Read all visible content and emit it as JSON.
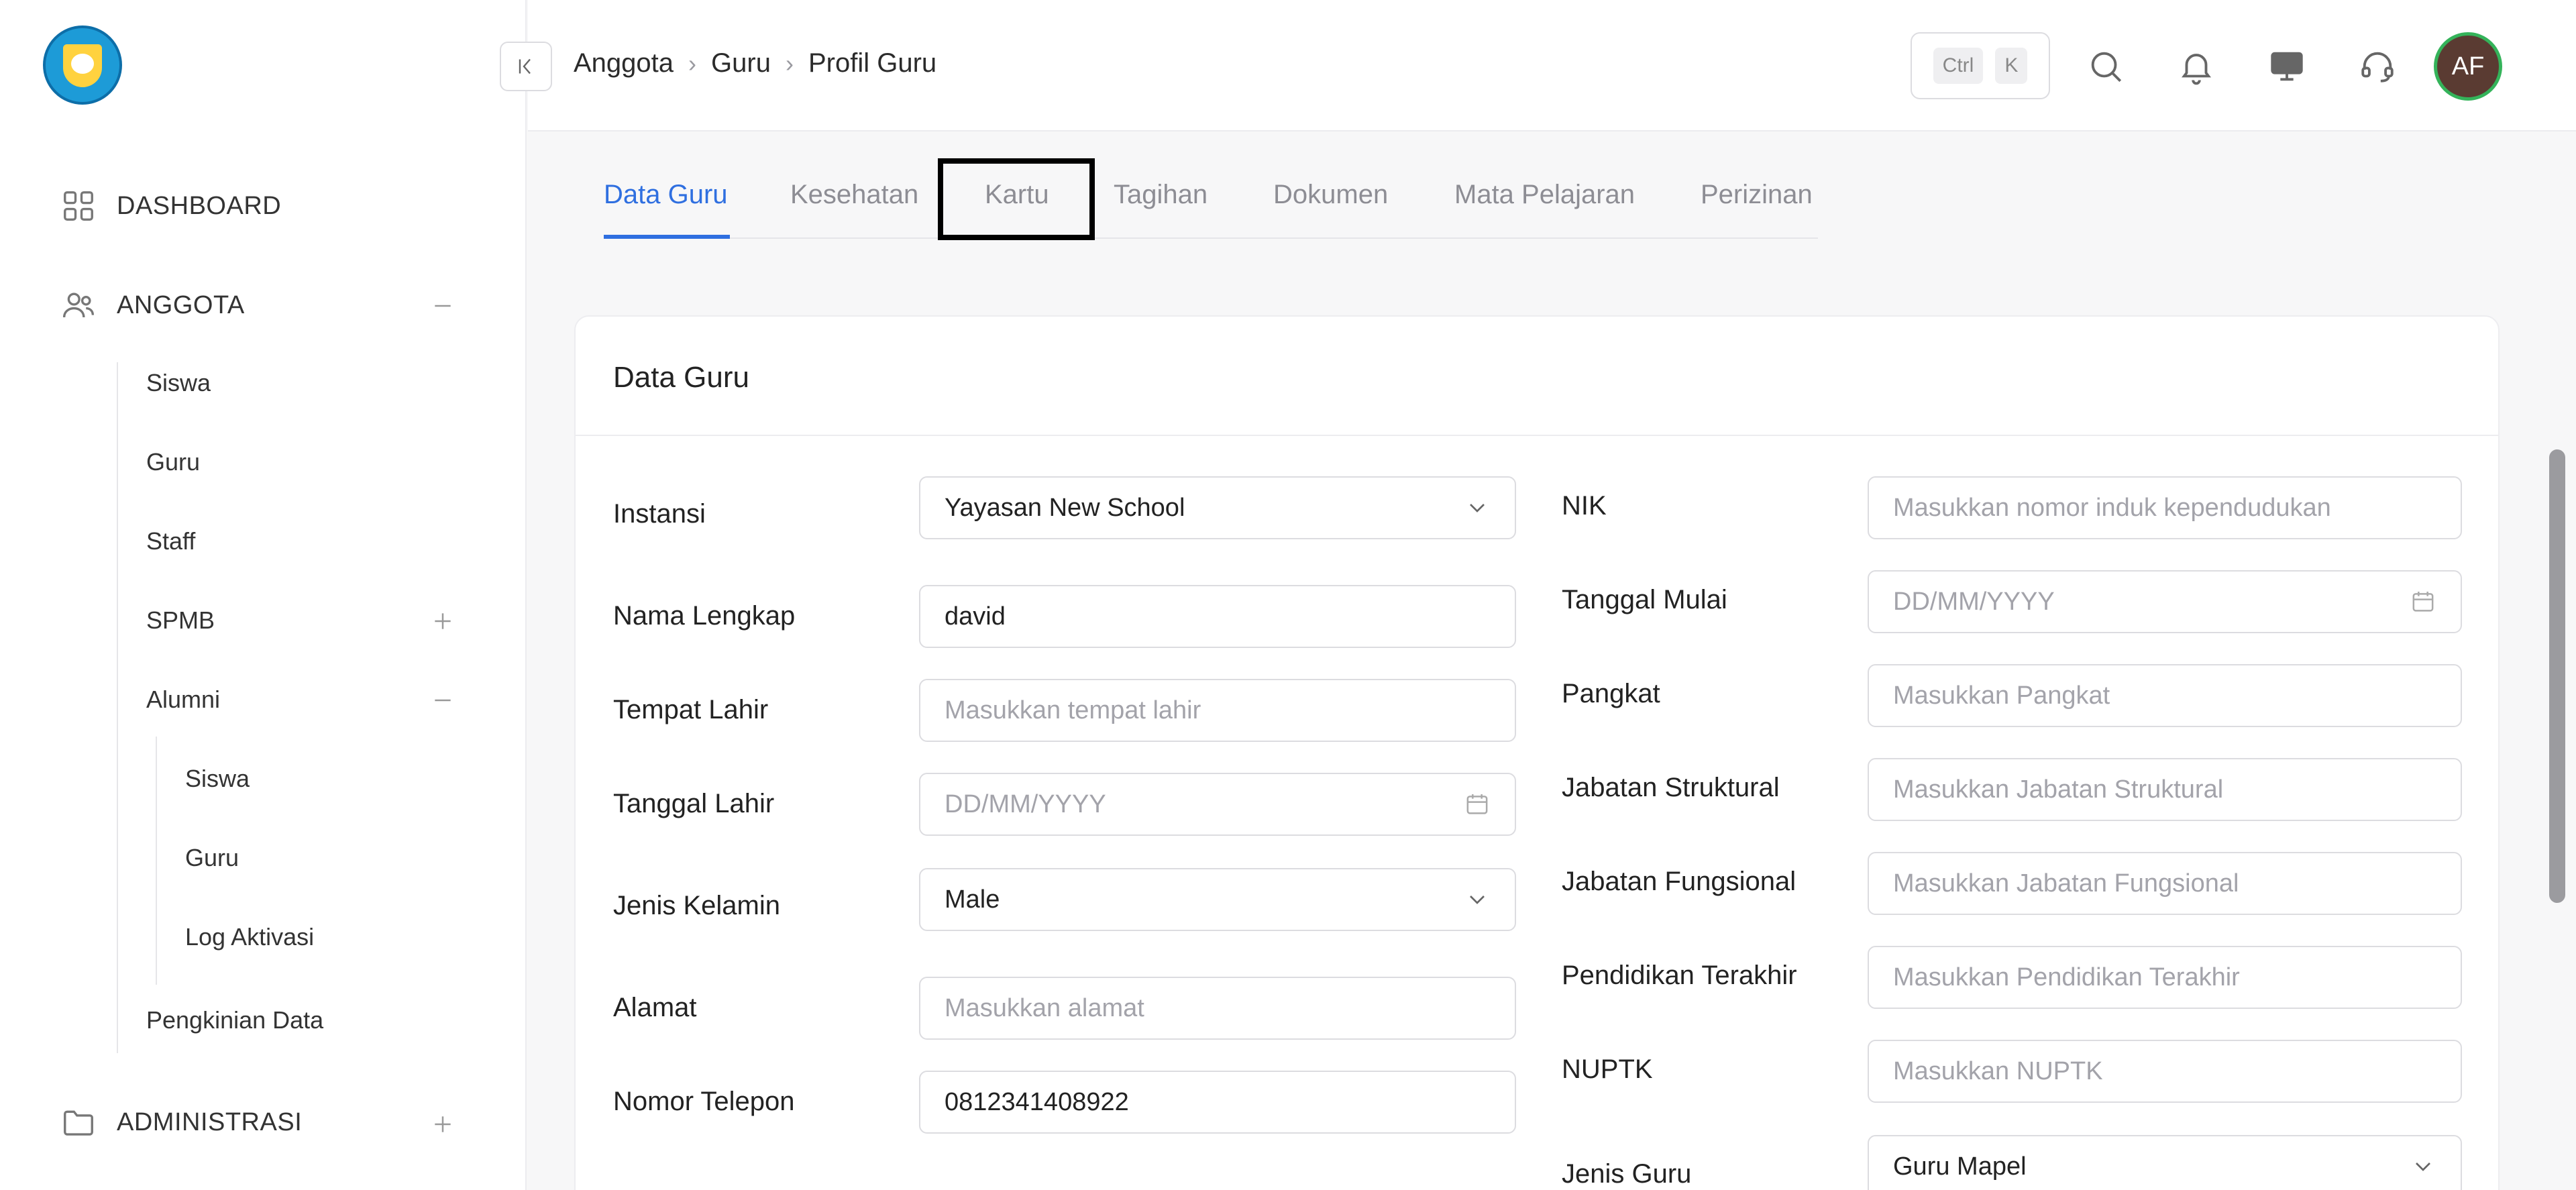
{
  "sidebar": {
    "dashboard": "DASHBOARD",
    "anggota": "ANGGOTA",
    "anggota_items": [
      "Siswa",
      "Guru",
      "Staff",
      "SPMB",
      "Alumni"
    ],
    "alumni_items": [
      "Siswa",
      "Guru",
      "Log Aktivasi"
    ],
    "pengkinian": "Pengkinian Data",
    "administrasi": "ADMINISTRASI"
  },
  "header": {
    "breadcrumb": [
      "Anggota",
      "Guru",
      "Profil Guru"
    ],
    "shortcut_keys": [
      "Ctrl",
      "K"
    ],
    "avatar_initials": "AF"
  },
  "tabs": [
    "Data Guru",
    "Kesehatan",
    "Kartu",
    "Tagihan",
    "Dokumen",
    "Mata Pelajaran",
    "Perizinan"
  ],
  "card": {
    "title": "Data Guru",
    "left_fields": [
      {
        "label": "Instansi",
        "value": "Yayasan New School",
        "placeholder": ""
      },
      {
        "label": "Nama Lengkap",
        "value": "david",
        "placeholder": ""
      },
      {
        "label": "Tempat Lahir",
        "value": "",
        "placeholder": "Masukkan tempat lahir"
      },
      {
        "label": "Tanggal Lahir",
        "value": "",
        "placeholder": "DD/MM/YYYY"
      },
      {
        "label": "Jenis Kelamin",
        "value": "Male",
        "placeholder": ""
      },
      {
        "label": "Alamat",
        "value": "",
        "placeholder": "Masukkan alamat"
      },
      {
        "label": "Nomor Telepon",
        "value": "0812341408922",
        "placeholder": ""
      }
    ],
    "right_fields": [
      {
        "label": "NIK",
        "value": "",
        "placeholder": "Masukkan nomor induk kependudukan"
      },
      {
        "label": "Tanggal Mulai",
        "value": "",
        "placeholder": "DD/MM/YYYY"
      },
      {
        "label": "Pangkat",
        "value": "",
        "placeholder": "Masukkan Pangkat"
      },
      {
        "label": "Jabatan Struktural",
        "value": "",
        "placeholder": "Masukkan Jabatan Struktural"
      },
      {
        "label": "Jabatan Fungsional",
        "value": "",
        "placeholder": "Masukkan Jabatan Fungsional"
      },
      {
        "label": "Pendidikan Terakhir",
        "value": "",
        "placeholder": "Masukkan Pendidikan Terakhir"
      },
      {
        "label": "NUPTK",
        "value": "",
        "placeholder": "Masukkan NUPTK"
      },
      {
        "label": "Jenis Guru",
        "value": "Guru Mapel",
        "placeholder": ""
      }
    ]
  },
  "colors": {
    "accent": "#2f6fe0",
    "avatar_bg": "#5a3b32",
    "avatar_ring": "#34b35a"
  }
}
